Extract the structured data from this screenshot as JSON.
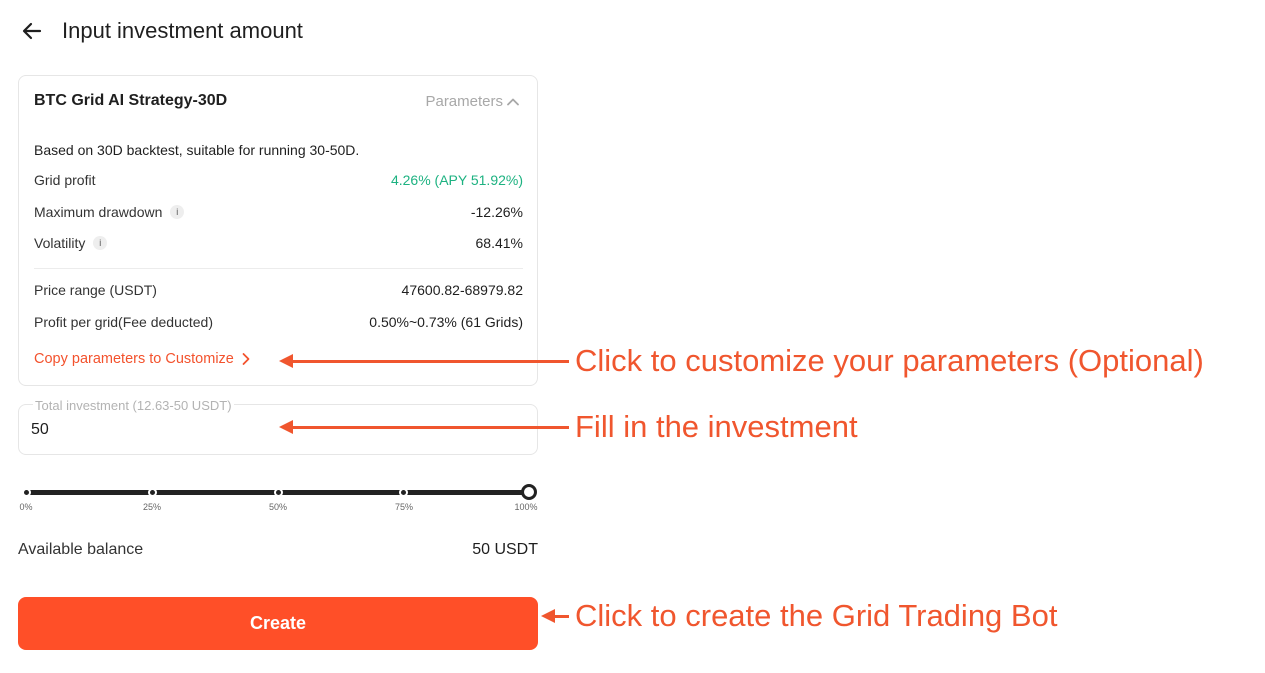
{
  "header": {
    "title": "Input investment amount",
    "back_icon": "arrow-left-icon"
  },
  "strategy": {
    "name": "BTC Grid AI Strategy-30D",
    "parameters_label": "Parameters",
    "description": "Based on 30D backtest, suitable for running 30-50D.",
    "rows": [
      {
        "label": "Grid profit",
        "value": "4.26% (APY 51.92%)",
        "has_info": false
      },
      {
        "label": "Maximum drawdown",
        "value": "-12.26%",
        "has_info": true
      },
      {
        "label": "Volatility",
        "value": "68.41%",
        "has_info": true
      },
      {
        "label": "Price range (USDT)",
        "value": "47600.82-68979.82",
        "has_info": false
      },
      {
        "label": "Profit per grid(Fee deducted)",
        "value": "0.50%~0.73% (61 Grids)",
        "has_info": false
      }
    ],
    "copy_link": "Copy parameters to Customize"
  },
  "investment": {
    "label": "Total investment (12.63-50 USDT)",
    "value": "50"
  },
  "slider": {
    "ticks": [
      "0%",
      "25%",
      "50%",
      "75%",
      "100%"
    ],
    "value_percent": 100
  },
  "balance": {
    "label": "Available balance",
    "value": "50 USDT"
  },
  "create_button": "Create",
  "annotations": {
    "customize": "Click to customize your parameters (Optional)",
    "investment": "Fill in the investment",
    "create": "Click to create the Grid Trading Bot"
  },
  "colors": {
    "accent": "#ff4f28",
    "annotation": "#f0562e",
    "positive": "#1db281",
    "link": "#f3522d"
  }
}
